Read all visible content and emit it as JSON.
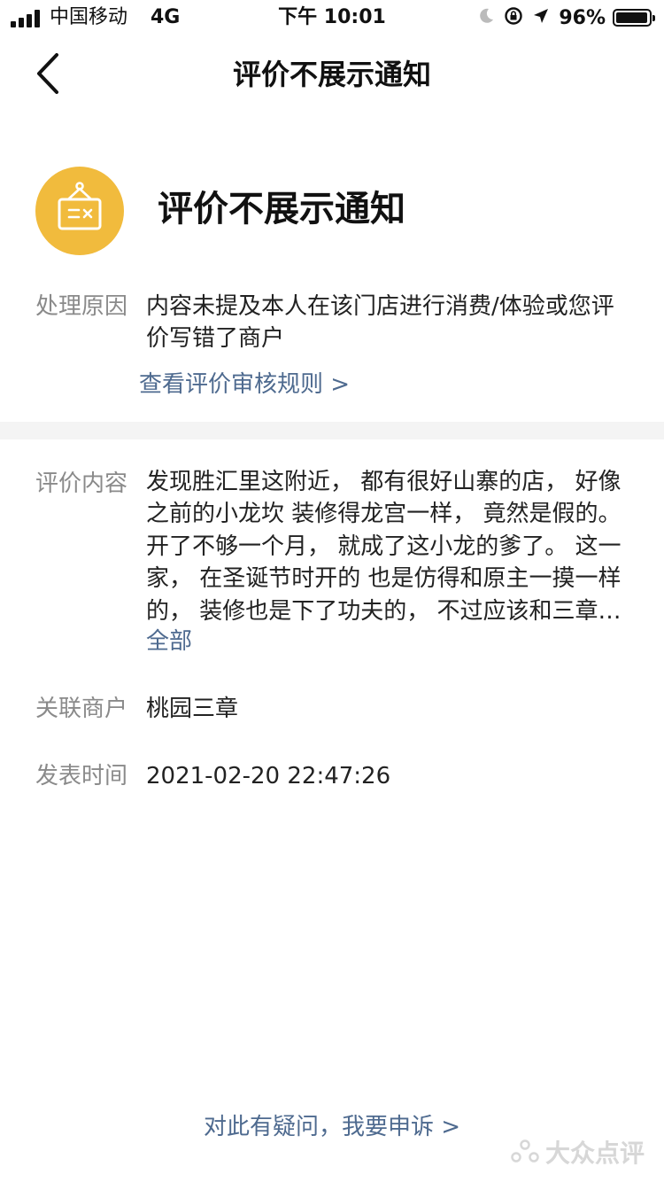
{
  "status_bar": {
    "carrier": "中国移动",
    "network": "4G",
    "time": "下午 10:01",
    "battery_percent": "96%",
    "battery_level": 0.96
  },
  "nav": {
    "title": "评价不展示通知"
  },
  "header": {
    "title": "评价不展示通知",
    "icon_color": "#F1BB3D"
  },
  "reason": {
    "label": "处理原因",
    "text": "内容未提及本人在该门店进行消费/体验或您评价写错了商户",
    "rules_link": "查看评价审核规则 >"
  },
  "review": {
    "label": "评价内容",
    "text": "发现胜汇里这附近， 都有很好山寨的店， 好像之前的小龙坎 装修得龙宫一样， 竟然是假的。开了不够一个月， 就成了这小龙的爹了。 这一家， 在圣诞节时开的 也是仿得和原主一摸一样的， 装修也是下了功夫的， 不过应该和三章…",
    "more": "全部"
  },
  "merchant": {
    "label": "关联商户",
    "value": "桃园三章"
  },
  "published": {
    "label": "发表时间",
    "value": "2021-02-20 22:47:26"
  },
  "appeal": {
    "link": "对此有疑问，我要申诉 >"
  },
  "watermark": {
    "text": "大众点评"
  },
  "colors": {
    "link": "#4E6A8F",
    "label": "#8a8a8a",
    "divider": "#F4F4F4"
  }
}
